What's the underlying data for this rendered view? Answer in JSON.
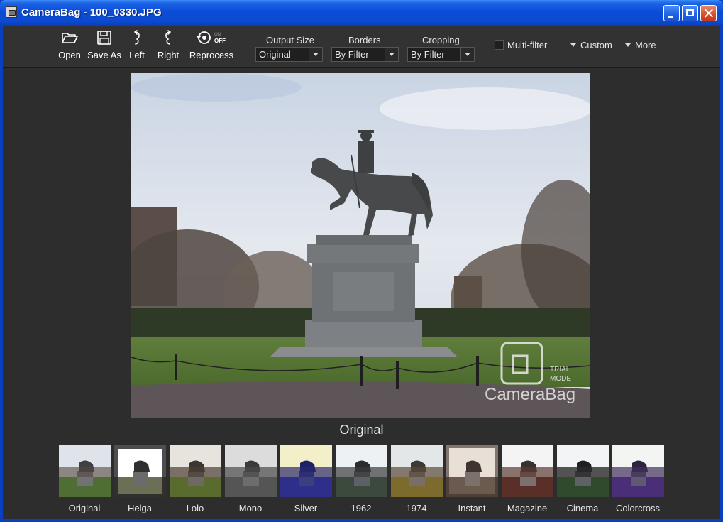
{
  "window": {
    "title": "CameraBag - 100_0330.JPG"
  },
  "toolbar": {
    "open": "Open",
    "save_as": "Save As",
    "left": "Left",
    "right": "Right",
    "reprocess": "Reprocess",
    "reprocess_toggle_on": "ON",
    "reprocess_toggle_off": "OFF",
    "output_size": {
      "label": "Output Size",
      "value": "Original"
    },
    "borders": {
      "label": "Borders",
      "value": "By Filter"
    },
    "cropping": {
      "label": "Cropping",
      "value": "By Filter"
    },
    "multi_filter": {
      "label": "Multi-filter",
      "checked": false
    },
    "custom": "Custom",
    "more": "More"
  },
  "preview": {
    "caption": "Original",
    "watermark_brand": "CameraBag",
    "watermark_line1": "TRIAL",
    "watermark_line2": "MODE"
  },
  "filters": [
    {
      "label": "Original",
      "tint": "none"
    },
    {
      "label": "Helga",
      "tint": "vignette-white"
    },
    {
      "label": "Lolo",
      "tint": "warm"
    },
    {
      "label": "Mono",
      "tint": "mono"
    },
    {
      "label": "Silver",
      "tint": "blue-yellow"
    },
    {
      "label": "1962",
      "tint": "cool-dark"
    },
    {
      "label": "1974",
      "tint": "faded-warm"
    },
    {
      "label": "Instant",
      "tint": "sepia-vignette"
    },
    {
      "label": "Magazine",
      "tint": "bright"
    },
    {
      "label": "Cinema",
      "tint": "contrast"
    },
    {
      "label": "Colorcross",
      "tint": "purple"
    }
  ],
  "colors": {
    "titlebar": "#0b4cd6",
    "client_bg": "#2d2d2d",
    "toolbar_bg": "#323232",
    "text": "#ffffff"
  }
}
